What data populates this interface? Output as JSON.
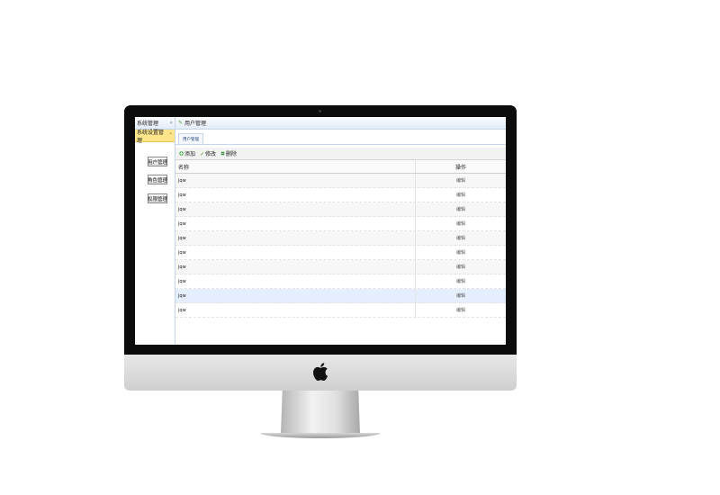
{
  "sidebar": {
    "title": "系统管理",
    "collapse_icon": "double-chevron-left-icon",
    "group_label": "系统设置管理",
    "group_icon": "chevron-up-icon",
    "buttons": [
      {
        "label": "用户管理"
      },
      {
        "label": "角色管理"
      },
      {
        "label": "权限管理"
      }
    ]
  },
  "main": {
    "title": "用户管理",
    "title_icon": "edit-icon",
    "tab_label": "用户管理",
    "toolbar": {
      "add_label": "添加",
      "edit_label": "修改",
      "delete_label": "删除"
    },
    "grid": {
      "columns": [
        "名称",
        "操作"
      ],
      "rows": [
        {
          "name": "jqw",
          "action": "编辑"
        },
        {
          "name": "jqw",
          "action": "编辑"
        },
        {
          "name": "jqw",
          "action": "编辑"
        },
        {
          "name": "jqw",
          "action": "编辑"
        },
        {
          "name": "jqw",
          "action": "编辑"
        },
        {
          "name": "jqw",
          "action": "编辑"
        },
        {
          "name": "jqw",
          "action": "编辑"
        },
        {
          "name": "jqw",
          "action": "编辑"
        },
        {
          "name": "jqw",
          "action": "编辑"
        },
        {
          "name": "jqw",
          "action": "编辑"
        }
      ],
      "selected_row_index": 8
    }
  },
  "colors": {
    "group_highlight": "#fde68a",
    "header_gradient_end": "#e3ecf8",
    "selected_row": "#e4eefc",
    "border": "#c6d6ea"
  }
}
